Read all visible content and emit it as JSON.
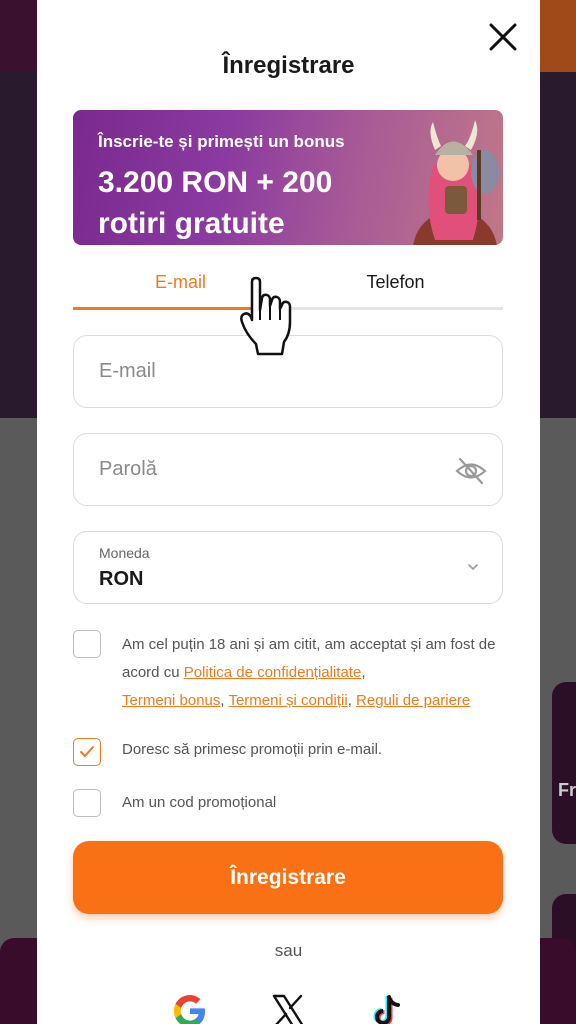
{
  "modal": {
    "title": "Înregistrare",
    "close_icon": "close-icon"
  },
  "banner": {
    "subtitle": "Înscrie-te și primești un bonus",
    "headline": "3.200 RON + 200 rotiri gratuite"
  },
  "tabs": [
    {
      "label": "E-mail",
      "active": true
    },
    {
      "label": "Telefon",
      "active": false
    }
  ],
  "form": {
    "email_placeholder": "E-mail",
    "password_placeholder": "Parolă",
    "password_toggle_icon": "eye-slash-icon",
    "currency_label": "Moneda",
    "currency_value": "RON",
    "currency_icon": "chevron-down-icon"
  },
  "terms": {
    "checked": false,
    "text_before": "Am cel puțin 18 ani și am citit, am acceptat și am fost de acord cu ",
    "link_privacy": "Politica de confidențialitate",
    "sep1": ",",
    "link_bonus": "Termeni bonus",
    "sep2": ", ",
    "link_terms": "Termeni și condiții",
    "sep3": ", ",
    "link_betting": "Reguli de pariere"
  },
  "promo_email": {
    "label": "Doresc să primesc promoții prin e-mail.",
    "checked": true
  },
  "promo_code": {
    "label": "Am un cod promoțional",
    "checked": false
  },
  "register_button": "Înregistrare",
  "or_text": "sau",
  "social": [
    "google-icon",
    "x-icon",
    "tiktok-icon"
  ],
  "colors": {
    "accent": "#fa7014",
    "tab_active": "#f07a1e"
  }
}
